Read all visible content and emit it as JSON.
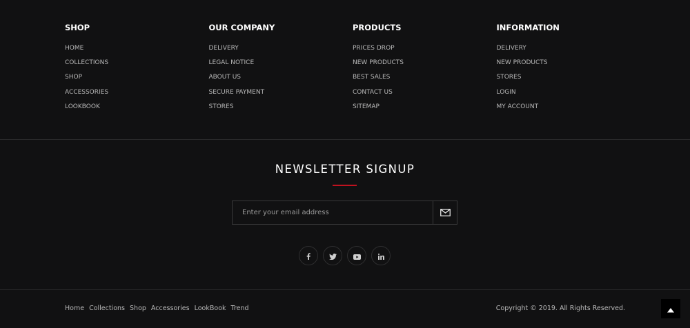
{
  "columns": [
    {
      "title": "SHOP",
      "items": [
        "HOME",
        "COLLECTIONS",
        "SHOP",
        "ACCESSORIES",
        "LOOKBOOK"
      ]
    },
    {
      "title": "OUR COMPANY",
      "items": [
        "DELIVERY",
        "LEGAL NOTICE",
        "ABOUT US",
        "SECURE PAYMENT",
        "STORES"
      ]
    },
    {
      "title": "PRODUCTS",
      "items": [
        "PRICES DROP",
        "NEW PRODUCTS",
        "BEST SALES",
        "CONTACT US",
        "SITEMAP"
      ]
    },
    {
      "title": "INFORMATION",
      "items": [
        "DELIVERY",
        "NEW PRODUCTS",
        "STORES",
        "LOGIN",
        "MY ACCOUNT"
      ]
    }
  ],
  "newsletter": {
    "title": "NEWSLETTER SIGNUP",
    "placeholder": "Enter your email address",
    "submit_icon": "envelope-icon"
  },
  "socials": [
    "facebook-icon",
    "twitter-icon",
    "youtube-icon",
    "linkedin-icon"
  ],
  "bottom_links": [
    "Home",
    "Collections",
    "Shop",
    "Accessories",
    "LookBook",
    "Trend"
  ],
  "copyright": "Copyright © 2019. All Rights Reserved.",
  "colors": {
    "background": "#111112",
    "accent": "#c1121f",
    "text": "#b9b9b9",
    "heading": "#ffffff"
  },
  "back_to_top_icon": "chevron-up-icon"
}
